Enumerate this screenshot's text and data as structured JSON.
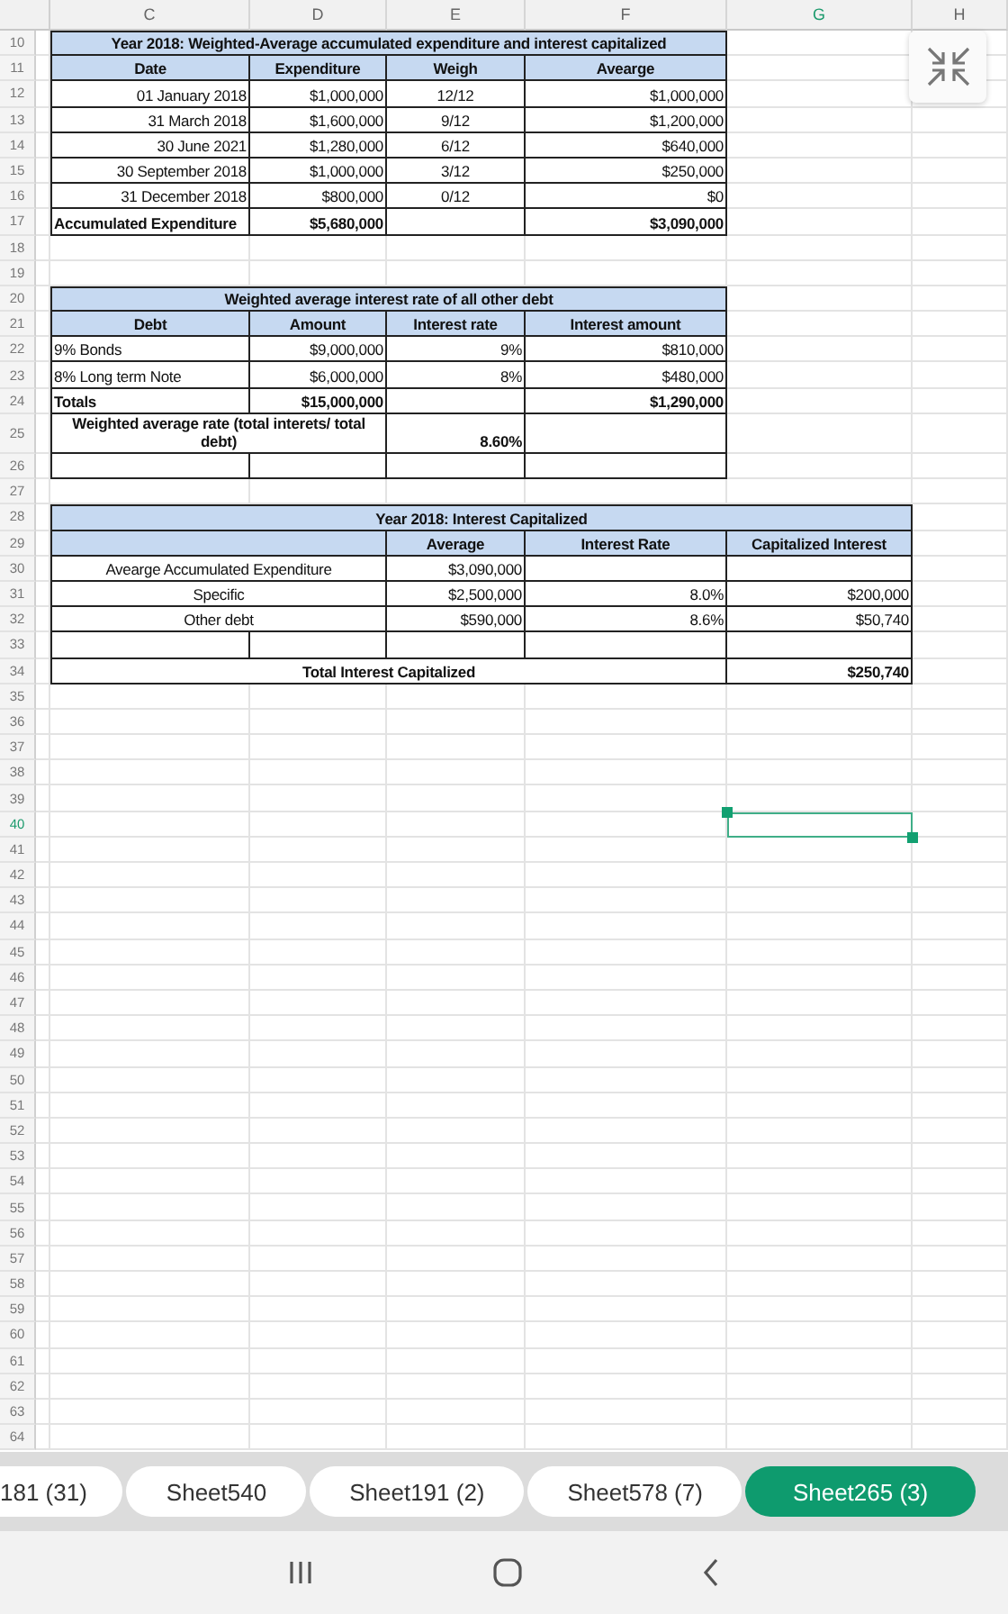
{
  "column_headers": [
    {
      "label": "C",
      "selected": false
    },
    {
      "label": "D",
      "selected": false
    },
    {
      "label": "E",
      "selected": false
    },
    {
      "label": "F",
      "selected": false
    },
    {
      "label": "G",
      "selected": true
    },
    {
      "label": "H",
      "selected": false
    }
  ],
  "row_headers": [
    {
      "label": "10",
      "selected": false
    },
    {
      "label": "11",
      "selected": false
    },
    {
      "label": "12",
      "selected": false
    },
    {
      "label": "13",
      "selected": false
    },
    {
      "label": "14",
      "selected": false
    },
    {
      "label": "15",
      "selected": false
    },
    {
      "label": "16",
      "selected": false
    },
    {
      "label": "17",
      "selected": false
    },
    {
      "label": "18",
      "selected": false
    },
    {
      "label": "19",
      "selected": false
    },
    {
      "label": "20",
      "selected": false
    },
    {
      "label": "21",
      "selected": false
    },
    {
      "label": "22",
      "selected": false
    },
    {
      "label": "23",
      "selected": false
    },
    {
      "label": "24",
      "selected": false
    },
    {
      "label": "25",
      "selected": false
    },
    {
      "label": "26",
      "selected": false
    },
    {
      "label": "27",
      "selected": false
    },
    {
      "label": "28",
      "selected": false
    },
    {
      "label": "29",
      "selected": false
    },
    {
      "label": "30",
      "selected": false
    },
    {
      "label": "31",
      "selected": false
    },
    {
      "label": "32",
      "selected": false
    },
    {
      "label": "33",
      "selected": false
    },
    {
      "label": "34",
      "selected": false
    },
    {
      "label": "35",
      "selected": false
    },
    {
      "label": "36",
      "selected": false
    },
    {
      "label": "37",
      "selected": false
    },
    {
      "label": "38",
      "selected": false
    },
    {
      "label": "39",
      "selected": false
    },
    {
      "label": "40",
      "selected": true
    },
    {
      "label": "41",
      "selected": false
    },
    {
      "label": "42",
      "selected": false
    },
    {
      "label": "43",
      "selected": false
    },
    {
      "label": "44",
      "selected": false
    },
    {
      "label": "45",
      "selected": false
    },
    {
      "label": "46",
      "selected": false
    },
    {
      "label": "47",
      "selected": false
    },
    {
      "label": "48",
      "selected": false
    },
    {
      "label": "49",
      "selected": false
    },
    {
      "label": "50",
      "selected": false
    },
    {
      "label": "51",
      "selected": false
    },
    {
      "label": "52",
      "selected": false
    },
    {
      "label": "53",
      "selected": false
    },
    {
      "label": "54",
      "selected": false
    },
    {
      "label": "55",
      "selected": false
    },
    {
      "label": "56",
      "selected": false
    },
    {
      "label": "57",
      "selected": false
    },
    {
      "label": "58",
      "selected": false
    },
    {
      "label": "59",
      "selected": false
    },
    {
      "label": "60",
      "selected": false
    },
    {
      "label": "61",
      "selected": false
    },
    {
      "label": "62",
      "selected": false
    },
    {
      "label": "63",
      "selected": false
    },
    {
      "label": "64",
      "selected": false
    }
  ],
  "tables": [
    {
      "title": "Year 2018: Weighted-Average accumulated expenditure and interest capitalized",
      "header": [
        "Date",
        "Expenditure",
        "Weigh",
        "Avearge"
      ],
      "rows": [
        {
          "kind": "data",
          "cells": [
            "01 January 2018",
            "$1,000,000",
            "12/12",
            "$1,000,000"
          ]
        },
        {
          "kind": "data",
          "cells": [
            "31 March 2018",
            "$1,600,000",
            "9/12",
            "$1,200,000"
          ]
        },
        {
          "kind": "data",
          "cells": [
            "30 June 2021",
            "$1,280,000",
            "6/12",
            "$640,000"
          ]
        },
        {
          "kind": "data",
          "cells": [
            "30 September 2018",
            "$1,000,000",
            "3/12",
            "$250,000"
          ]
        },
        {
          "kind": "data",
          "cells": [
            "31 December 2018",
            "$800,000",
            "0/12",
            "$0"
          ]
        },
        {
          "kind": "total",
          "cells": [
            "Accumulated Expenditure",
            "$5,680,000",
            "",
            "$3,090,000"
          ]
        }
      ]
    },
    {
      "title": "Weighted average interest rate of all other debt",
      "header": [
        "Debt",
        "Amount",
        "Interest rate",
        "Interest amount"
      ],
      "rows": [
        {
          "kind": "data",
          "cells": [
            "9% Bonds",
            "$9,000,000",
            "9%",
            "$810,000"
          ]
        },
        {
          "kind": "data",
          "cells": [
            "8% Long term Note",
            "$6,000,000",
            "8%",
            "$480,000"
          ]
        },
        {
          "kind": "total",
          "cells": [
            "Totals",
            "$15,000,000",
            "",
            "$1,290,000"
          ]
        },
        {
          "kind": "note",
          "cells": [
            "Weighted average rate (total interets/ total debt)",
            "",
            "8.60%",
            ""
          ]
        },
        {
          "kind": "blank",
          "cells": [
            "",
            "",
            "",
            ""
          ]
        }
      ]
    },
    {
      "title": "Year 2018: Interest Capitalized",
      "header": [
        "Average",
        "Interest Rate",
        "Capitalized Interest"
      ],
      "rows": [
        {
          "kind": "data",
          "cells": [
            "Avearge Accumulated Expenditure",
            "",
            "$3,090,000",
            "",
            ""
          ]
        },
        {
          "kind": "data",
          "cells": [
            "Specific",
            "",
            "$2,500,000",
            "8.0%",
            "$200,000"
          ]
        },
        {
          "kind": "data",
          "cells": [
            "Other debt",
            "",
            "$590,000",
            "8.6%",
            "$50,740"
          ]
        },
        {
          "kind": "blank",
          "cells": [
            "",
            "",
            "",
            "",
            ""
          ]
        },
        {
          "kind": "total",
          "cells": [
            "Total Interest Capitalized",
            "",
            "",
            "",
            "$250,740"
          ]
        }
      ]
    }
  ],
  "sheet_tabs": [
    {
      "label": "181 (31)",
      "selected": false
    },
    {
      "label": "Sheet540",
      "selected": false
    },
    {
      "label": "Sheet191 (2)",
      "selected": false
    },
    {
      "label": "Sheet578 (7)",
      "selected": false
    },
    {
      "label": "Sheet265 (3)",
      "selected": true
    }
  ]
}
